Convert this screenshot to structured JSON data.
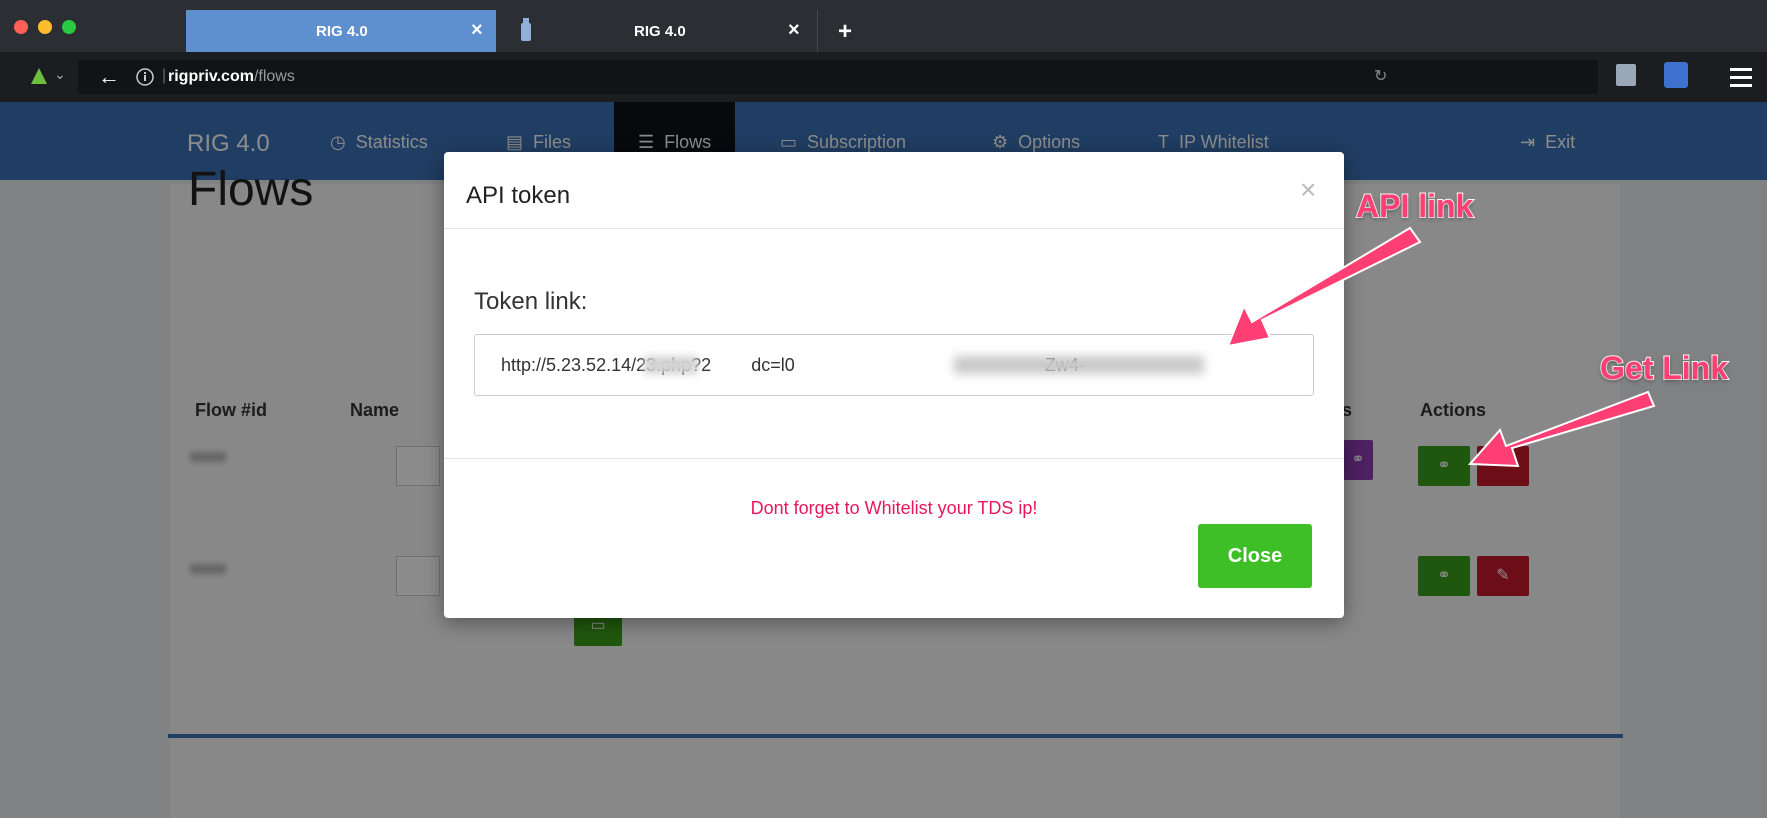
{
  "browser": {
    "tabs": [
      {
        "title": "RIG 4.0",
        "close": "×"
      },
      {
        "title": "RIG 4.0",
        "close": "×"
      }
    ],
    "new_tab": "+",
    "url_host": "rigpriv.com",
    "url_path": "/flows"
  },
  "nav": {
    "brand": "RIG 4.0",
    "items": [
      "Statistics",
      "Files",
      "Flows",
      "Subscription",
      "Options",
      "IP Whitelist"
    ],
    "exit": "Exit"
  },
  "page": {
    "title": "Flows",
    "columns": [
      "Flow #id",
      "Name",
      "s",
      "Actions"
    ]
  },
  "modal": {
    "title": "API token",
    "close_x": "×",
    "token_label": "Token link:",
    "token_value": "http://5.23.52.14/23.php?2        dc=l0                                                  Zw4-",
    "warning": "Dont forget to Whitelist your TDS ip!",
    "close_button": "Close"
  },
  "annotations": {
    "api_link": "API link",
    "get_link": "Get Link"
  },
  "colors": {
    "nav_bg": "#3b72b5",
    "tab_active": "#5e8fcf",
    "warning_text": "#e8175d",
    "close_btn": "#3fbf27",
    "annotation": "#ff3f74"
  }
}
